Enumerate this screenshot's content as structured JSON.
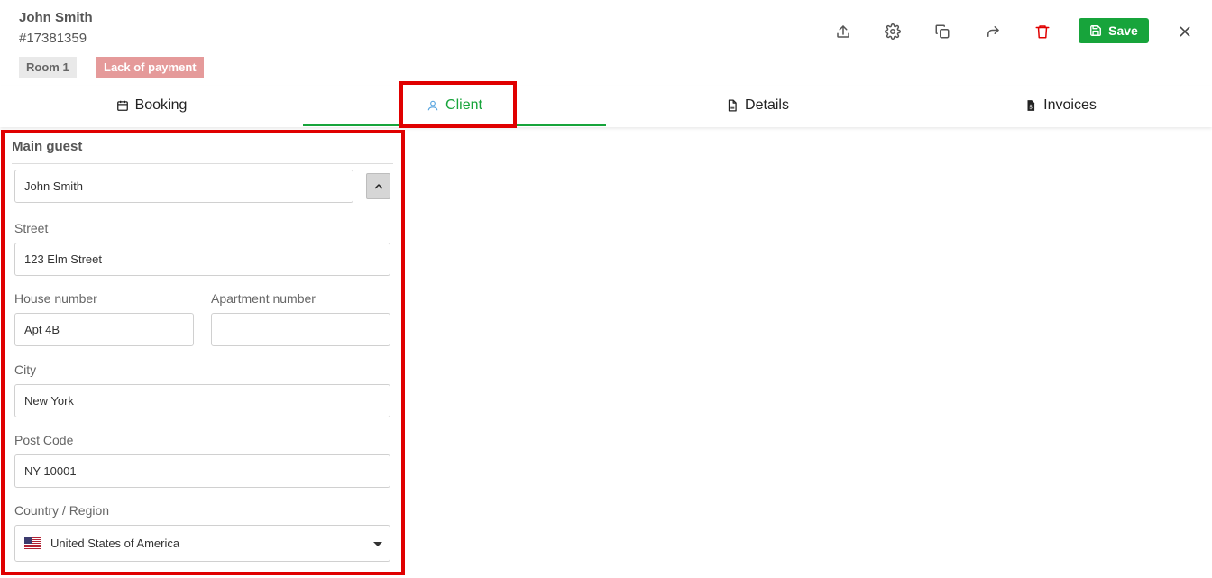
{
  "header": {
    "guest_name": "John Smith",
    "booking_id": "#17381359",
    "room_badge": "Room 1",
    "status_badge": "Lack of payment"
  },
  "toolbar": {
    "icons": [
      "upload-icon",
      "gear-icon",
      "copy-icon",
      "share-icon",
      "trash-icon",
      "close-icon"
    ],
    "save_label": "Save",
    "colors": {
      "save": "#17a43b",
      "delete": "#e00000"
    }
  },
  "tabs": [
    {
      "label": "Booking",
      "icon": "calendar-icon"
    },
    {
      "label": "Client",
      "icon": "user-icon",
      "active": true
    },
    {
      "label": "Details",
      "icon": "document-icon"
    },
    {
      "label": "Invoices",
      "icon": "invoice-icon"
    }
  ],
  "form": {
    "section_title": "Main guest",
    "guest_select_value": "John Smith",
    "street_label": "Street",
    "street_value": "123 Elm Street",
    "house_label": "House number",
    "house_value": "Apt 4B",
    "apartment_label": "Apartment number",
    "apartment_value": "",
    "city_label": "City",
    "city_value": "New York",
    "postcode_label": "Post Code",
    "postcode_value": "NY 10001",
    "country_label": "Country / Region",
    "country_value": "United States of America",
    "country_flag": "us-flag-icon"
  }
}
